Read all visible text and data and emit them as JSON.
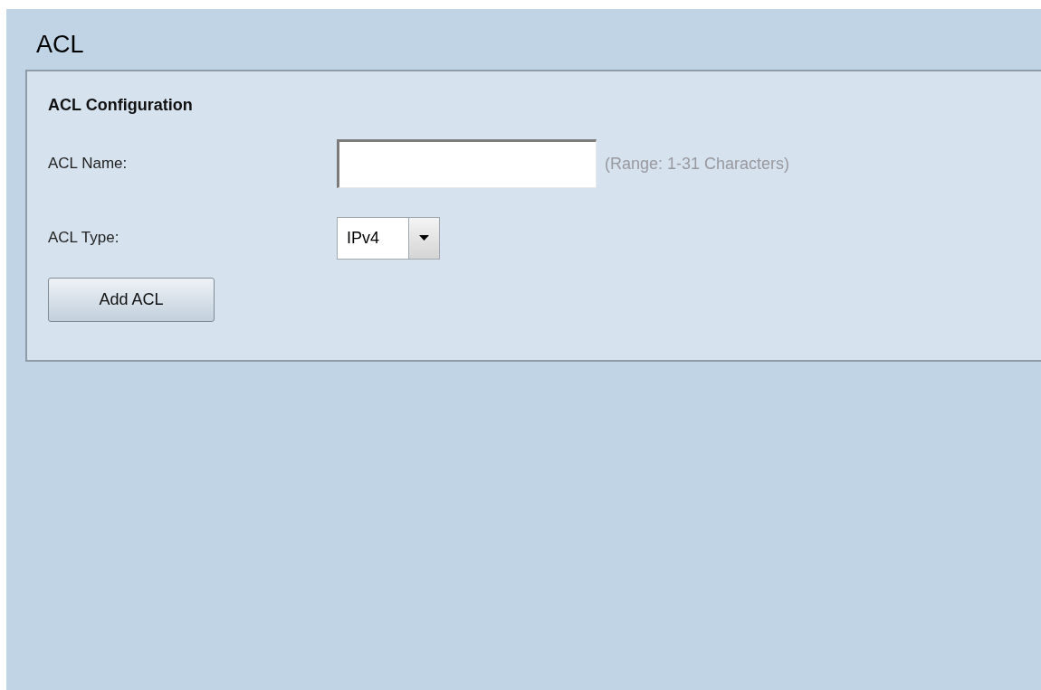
{
  "page": {
    "title": "ACL"
  },
  "panel": {
    "title": "ACL Configuration",
    "fields": [
      {
        "kind": "text",
        "label": "ACL Name:",
        "hint": "(Range: 1-31 Characters)"
      },
      {
        "kind": "select",
        "label": "ACL Type:",
        "value": "IPv4"
      }
    ],
    "buttons": [
      "Add ACL"
    ]
  }
}
